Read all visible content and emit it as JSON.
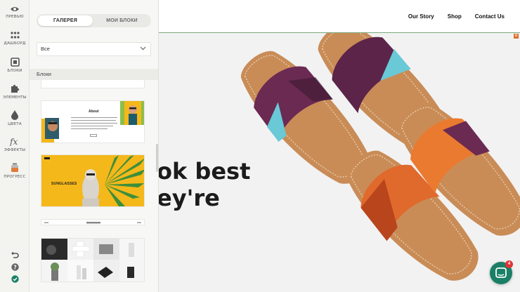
{
  "rail": {
    "items": [
      {
        "label": "ПРЕВЬЮ",
        "icon": "eye-icon"
      },
      {
        "label": "ДАШБОРД",
        "icon": "dashboard-grid-icon"
      },
      {
        "label": "БЛОКИ",
        "icon": "blocks-icon"
      },
      {
        "label": "ЭЛЕМЕНТЫ",
        "icon": "puzzle-icon"
      },
      {
        "label": "ЦВЕТА",
        "icon": "color-drop-icon"
      },
      {
        "label": "ЭФФЕКТЫ",
        "icon": "effects-fx-icon"
      },
      {
        "label": "ПРОГРЕСС",
        "icon": "progress-jar-icon"
      }
    ],
    "bottom_icons": [
      "undo-icon",
      "help-icon",
      "check-circle-icon"
    ]
  },
  "panel": {
    "tabs": [
      {
        "label": "ГАЛЕРЕЯ",
        "active": true
      },
      {
        "label": "МОИ БЛОКИ",
        "active": false
      }
    ],
    "filter_value": "Все",
    "section_label": "Блоки",
    "thumbs": {
      "about_title": "About",
      "sunglasses_title": "SUNGLASSES"
    }
  },
  "site": {
    "nav": [
      "Our Story",
      "Shop",
      "Contact Us"
    ],
    "hero_title": "ok best\ney're"
  },
  "chat": {
    "badge_count": "4"
  },
  "colors": {
    "accent_green": "#1a7f66",
    "badge_red": "#e03333",
    "sunglasses_bg": "#f4b81a"
  }
}
